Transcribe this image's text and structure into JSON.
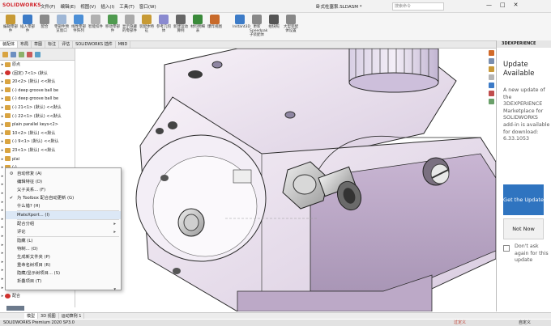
{
  "app": {
    "brand": "SOLIDWORKS",
    "doc_title": "卧式柱塞泵.SLDASM *",
    "search_placeholder": "搜索命令"
  },
  "menus": [
    "文件(F)",
    "编辑(E)",
    "视图(V)",
    "插入(I)",
    "工具(T)",
    "窗口(W)"
  ],
  "window_controls": {
    "min": "—",
    "max": "□",
    "close": "✕"
  },
  "ribbon": [
    {
      "label": "编辑零部件",
      "color": "#c79a35"
    },
    {
      "label": "插入零部件",
      "color": "#3c7bc7"
    },
    {
      "label": "配合",
      "color": "#8a8a8a"
    },
    {
      "label": "零部件预览窗口",
      "color": "#9fb7d6"
    },
    {
      "label": "线性零部件阵列",
      "color": "#4c8fd6"
    },
    {
      "label": "智能扣件",
      "color": "#b0b0b0"
    },
    {
      "label": "移动零部件",
      "color": "#4f9a4f"
    },
    {
      "label": "显示隐藏的零部件",
      "color": "#aaa"
    },
    {
      "label": "装配体特征",
      "color": "#c79a35"
    },
    {
      "label": "参考几何体",
      "color": "#8a8ad0"
    },
    {
      "label": "新建运动算例",
      "color": "#666"
    },
    {
      "label": "材料明细表",
      "color": "#3a8a3a"
    },
    {
      "label": "爆炸视图",
      "color": "#c86a2a"
    },
    {
      "label": "Instant3D",
      "color": "#3c7bc7"
    },
    {
      "label": "更新Speedpak子装配体",
      "color": "#888"
    },
    {
      "label": "拍快照",
      "color": "#555"
    },
    {
      "label": "大型装配体设置",
      "color": "#888"
    }
  ],
  "command_tabs": [
    "装配体",
    "布局",
    "草图",
    "标注",
    "评估",
    "SOLIDWORKS 插件",
    "MBD"
  ],
  "tree_rows": [
    {
      "text": "原点",
      "icon": "origin"
    },
    {
      "text": "(固定) 7<1> (默认",
      "icon": "red"
    },
    {
      "text": "20<2> (默认) <<默认",
      "icon": "part"
    },
    {
      "text": "(-) deep groove ball be",
      "icon": "part"
    },
    {
      "text": "(-) deep groove ball be",
      "icon": "part"
    },
    {
      "text": "(-) 21<1> (默认) <<默认",
      "icon": "part"
    },
    {
      "text": "(-) 22<1> (默认) <<默认",
      "icon": "part"
    },
    {
      "text": "plain parallel keys<2>",
      "icon": "part"
    },
    {
      "text": "10<2> (默认) <<默认",
      "icon": "part"
    },
    {
      "text": "(-) 9<1> (默认) <<默认",
      "icon": "part"
    },
    {
      "text": "23<1> (默认) <<默认",
      "icon": "part"
    },
    {
      "text": "plai",
      "icon": "part"
    },
    {
      "text": "(-)",
      "icon": "part"
    },
    {
      "text": "(-)",
      "icon": "part"
    },
    {
      "text": "(-) 1",
      "icon": "part"
    },
    {
      "text": "(-) 1",
      "icon": "part"
    },
    {
      "text": "17<",
      "icon": "part"
    },
    {
      "text": "(-)",
      "icon": "part"
    },
    {
      "text": "(-)",
      "icon": "red"
    },
    {
      "text": "(-)",
      "icon": "warn"
    },
    {
      "text": "(-)",
      "icon": "part"
    },
    {
      "text": "(-)",
      "icon": "red"
    },
    {
      "text": "(-)",
      "icon": "warn"
    },
    {
      "text": "(-)",
      "icon": "part"
    },
    {
      "text": "(-)",
      "icon": "warn"
    },
    {
      "text": "(-)",
      "icon": "part"
    },
    {
      "text": "(-)",
      "icon": "part"
    },
    {
      "text": "配合",
      "icon": "red"
    }
  ],
  "context_menu": [
    {
      "label": "自动修复 (A)",
      "icon": "⚙",
      "sub": ""
    },
    {
      "label": "编辑特征 (D)",
      "icon": "",
      "sub": ""
    },
    {
      "label": "父子关系... (F)",
      "icon": "",
      "sub": ""
    },
    {
      "label": "为 Toolbox 配合自动更新 (G)",
      "icon": "✔",
      "sub": ""
    },
    {
      "label": "什么错? (H)",
      "icon": "",
      "sub": ""
    },
    {
      "label": "MateXpert... (I)",
      "icon": "",
      "sub": "",
      "hl": true
    },
    {
      "label": "配合分组",
      "icon": "",
      "sub": "▸"
    },
    {
      "label": "评论",
      "icon": "",
      "sub": "▸"
    },
    {
      "label": "隐藏 (L)",
      "icon": "",
      "sub": ""
    },
    {
      "label": "特制... (O)",
      "icon": "",
      "sub": ""
    },
    {
      "label": "生成新文件夹 (P)",
      "icon": "",
      "sub": ""
    },
    {
      "label": "重命名树项目 (R)",
      "icon": "",
      "sub": ""
    },
    {
      "label": "隐藏/显示树项目... (S)",
      "icon": "",
      "sub": ""
    },
    {
      "label": "折叠项目 (T)",
      "icon": "",
      "sub": ""
    },
    {
      "label": "",
      "icon": "",
      "sub": "▾"
    }
  ],
  "update_panel": {
    "header": "3DEXPERIENCE",
    "title": "Update Available",
    "body": "A new update of the 3DEXPERIENCE Marketplace for SOLIDWORKS add-in is available for download: 6.33.1053",
    "get_button": "Get the Update",
    "not_now_button": "Not Now",
    "dont_ask": "Don't ask again for this update"
  },
  "bottom_tabs": [
    "模型",
    "3D 视图",
    "运动算例 1"
  ],
  "status": {
    "left": "SOLIDWORKS Premium 2020 SP3.0",
    "warn": "过定义",
    "editing": "在编辑 装配体",
    "custom": "自定义"
  }
}
